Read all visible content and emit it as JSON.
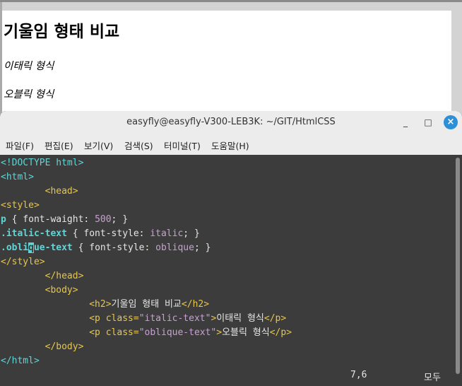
{
  "browser": {
    "heading": "기울임 형태 비교",
    "italic_paragraph": "이태릭 형식",
    "oblique_paragraph": "오블릭 형식"
  },
  "terminal": {
    "title": "easyfly@easyfly-V300-LEB3K: ~/GIT/HtmlCSS",
    "controls": {
      "minimize": "_",
      "maximize": "□",
      "close": "×"
    },
    "menu": [
      "파일(F)",
      "편집(E)",
      "보기(V)",
      "검색(S)",
      "터미널(T)",
      "도움말(H)"
    ],
    "code": {
      "doctype": "<!DOCTYPE html>",
      "html_open": "<html>",
      "head_open": "<head>",
      "style_open": "<style>",
      "rule_p_selector": "p",
      "rule_p_body": " { font-waight: ",
      "rule_p_value": "500",
      "rule_p_end": "; }",
      "rule_italic_selector": ".italic-text",
      "rule_italic_body": " { font-style: ",
      "rule_italic_value": "italic",
      "rule_italic_end": "; }",
      "rule_oblique_selector_a": ".obli",
      "rule_oblique_cursor": "q",
      "rule_oblique_selector_b": "ue-text",
      "rule_oblique_body": " { font-style: ",
      "rule_oblique_value": "oblique",
      "rule_oblique_end": "; }",
      "style_close": "</style>",
      "head_close": "</head>",
      "body_open": "<body>",
      "h2_open": "<h2>",
      "h2_text": "기울임 형태 비교",
      "h2_close": "</h2>",
      "p_open_a": "<p class=",
      "p_italic_class": "\"italic-text\"",
      "p_open_b": ">",
      "p_italic_text": "이태릭 형식",
      "p_close": "</p>",
      "p_oblique_class": "\"oblique-text\"",
      "p_oblique_text": "오블릭 형식",
      "body_close": "</body>",
      "html_close": "</html>"
    },
    "status": {
      "position": "7,6",
      "scroll": "모두"
    }
  },
  "colors": {
    "terminal_bg": "#3c3c3c",
    "tag": "#5ed6d8",
    "keyword": "#e8c64a",
    "value": "#c7a0d2",
    "close_button": "#2d8fd6"
  }
}
